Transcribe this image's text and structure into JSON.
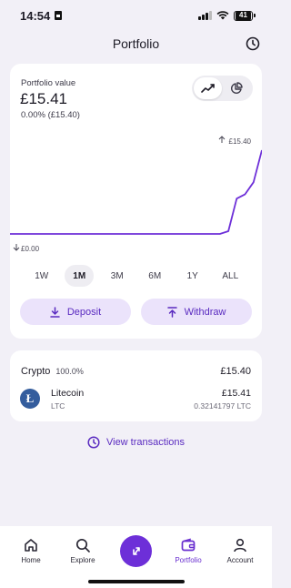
{
  "status": {
    "time": "14:54",
    "battery": "41"
  },
  "header": {
    "title": "Portfolio"
  },
  "portfolio": {
    "label": "Portfolio value",
    "value": "£15.41",
    "change": "0.00% (£15.40)"
  },
  "chart_data": {
    "type": "line",
    "max_label": "£15.40",
    "min_label": "£0.00",
    "series": [
      {
        "values": [
          0,
          0,
          0,
          0,
          0,
          0,
          0,
          0,
          0,
          0,
          0,
          0,
          0,
          0,
          0,
          0,
          0,
          0,
          0,
          0,
          0,
          0,
          0,
          0,
          0,
          0,
          0.5,
          6.5,
          7.3,
          9.5,
          15.4
        ]
      }
    ],
    "ylim": [
      0,
      15.4
    ],
    "grid": false
  },
  "ranges": [
    "1W",
    "1M",
    "3M",
    "6M",
    "1Y",
    "ALL"
  ],
  "selected_range": "1M",
  "actions": {
    "deposit": "Deposit",
    "withdraw": "Withdraw"
  },
  "crypto": {
    "title": "Crypto",
    "percent": "100.0%",
    "total": "£15.40",
    "coin": {
      "name": "Litecoin",
      "ticker": "LTC",
      "value": "£15.41",
      "amount": "0.32141797 LTC"
    }
  },
  "view_transactions": "View transactions",
  "nav": {
    "home": "Home",
    "explore": "Explore",
    "portfolio": "Portfolio",
    "account": "Account"
  },
  "colors": {
    "accent": "#6d2fd8",
    "accent_light": "#ebe3fb",
    "background": "#f2f0f7",
    "coin": "#345d9d"
  }
}
